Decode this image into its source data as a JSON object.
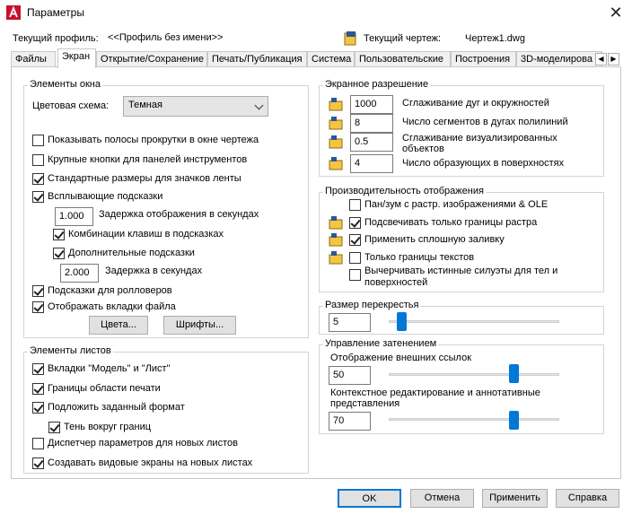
{
  "window": {
    "title": "Параметры",
    "close": "✕"
  },
  "profile": {
    "label": "Текущий профиль:",
    "value": "<<Профиль без имени>>"
  },
  "drawing": {
    "label": "Текущий чертеж:",
    "value": "Чертеж1.dwg"
  },
  "tabs": [
    "Файлы",
    "Экран",
    "Открытие/Сохранение",
    "Печать/Публикация",
    "Система",
    "Пользовательские",
    "Построения",
    "3D-моделирова"
  ],
  "active_tab": "Экран",
  "window_elements": {
    "title": "Элементы окна",
    "color_scheme_label": "Цветовая схема:",
    "color_scheme_value": "Темная",
    "options": [
      {
        "label": "Показывать полосы прокрутки в окне чертежа",
        "checked": false
      },
      {
        "label": "Крупные кнопки для панелей инструментов",
        "checked": false
      },
      {
        "label": "Стандартные размеры для значков ленты",
        "checked": true
      },
      {
        "label": "Всплывающие подсказки",
        "checked": true
      }
    ],
    "tooltip_delay_value": "1.000",
    "tooltip_delay_label": "Задержка отображения в секундах",
    "shortcut_keys": {
      "label": "Комбинации клавиш в подсказках",
      "checked": true
    },
    "extended_tooltips": {
      "label": "Дополнительные подсказки",
      "checked": true
    },
    "extended_delay_value": "2.000",
    "extended_delay_label": "Задержка в секундах",
    "rollover": {
      "label": "Подсказки для ролловеров",
      "checked": true
    },
    "file_tabs": {
      "label": "Отображать вкладки файла",
      "checked": true
    },
    "colors_button": "Цвета...",
    "fonts_button": "Шрифты..."
  },
  "layout_elements": {
    "title": "Элементы листов",
    "options": [
      {
        "label": "Вкладки \"Модель\" и \"Лист\"",
        "checked": true
      },
      {
        "label": "Границы области печати",
        "checked": true
      },
      {
        "label": "Подложить заданный формат",
        "checked": true
      },
      {
        "label": "Тень вокруг границ",
        "checked": true
      },
      {
        "label": "Диспетчер параметров для новых листов",
        "checked": false
      },
      {
        "label": "Создавать видовые экраны на новых листах",
        "checked": true
      }
    ]
  },
  "resolution": {
    "title": "Экранное разрешение",
    "rows": [
      {
        "value": "1000",
        "label": "Сглаживание дуг и окружностей"
      },
      {
        "value": "8",
        "label": "Число сегментов в дугах полилиний"
      },
      {
        "value": "0.5",
        "label": "Сглаживание визуализированных объектов"
      },
      {
        "value": "4",
        "label": "Число образующих в поверхностях"
      }
    ]
  },
  "performance": {
    "title": "Производительность отображения",
    "options": [
      {
        "label": "Пан/зум с растр. изображениями & OLE",
        "checked": false
      },
      {
        "label": "Подсвечивать только границы растра",
        "checked": true
      },
      {
        "label": "Применить сплошную заливку",
        "checked": true
      },
      {
        "label": "Только границы текстов",
        "checked": false
      },
      {
        "label": "Вычерчивать истинные силуэты для тел и поверхностей",
        "checked": false
      }
    ]
  },
  "crosshair": {
    "title": "Размер перекрестья",
    "value": "5",
    "level": 0.05
  },
  "fading": {
    "title": "Управление затенением",
    "xref_label": "Отображение внешних ссылок",
    "xref_value": "50",
    "xref_level": 0.75,
    "inplace_label": "Контекстное редактирование и аннотативные представления",
    "inplace_value": "70",
    "inplace_level": 0.75
  },
  "buttons": {
    "ok": "OK",
    "cancel": "Отмена",
    "apply": "Применить",
    "help": "Справка"
  },
  "colors": {
    "accent": "#0078d7",
    "autocad_red": "#c8102e"
  }
}
